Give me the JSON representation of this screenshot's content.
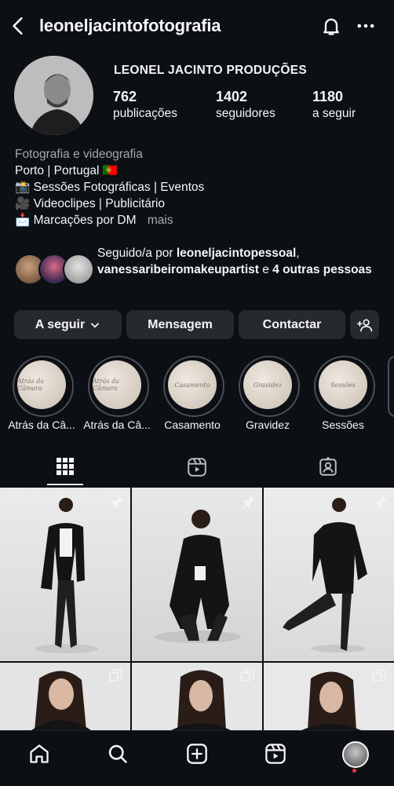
{
  "header": {
    "username": "leoneljacintofotografia",
    "back_icon": "chevron-left-icon",
    "bell_icon": "bell-icon",
    "more_icon": "more-horizontal-icon"
  },
  "profile": {
    "display_name": "LEONEL JACINTO PRODUÇÕES",
    "stats": [
      {
        "value": "762",
        "label": "publicações"
      },
      {
        "value": "1402",
        "label": "seguidores"
      },
      {
        "value": "1180",
        "label": "a seguir"
      }
    ],
    "bio": {
      "category": "Fotografia e videografia",
      "lines": [
        "Porto | Portugal 🇵🇹",
        "📸 Sessões Fotográficas | Eventos",
        "🎥 Videoclipes | Publicitário",
        "📩 Marcações por DM"
      ],
      "more": "mais"
    },
    "followed_by": {
      "prefix": "Seguido/a por ",
      "user1": "leoneljacintopessoal",
      "sep": ",",
      "user2": "vanessaribeiromakeupartist",
      "conj": " e ",
      "others": "4 outras pessoas"
    }
  },
  "actions": {
    "following": "A seguir",
    "message": "Mensagem",
    "contact": "Contactar"
  },
  "highlights": [
    {
      "label": "Atrás da Câ...",
      "cover": "Atrás da Câmara"
    },
    {
      "label": "Atrás da Câ...",
      "cover": "Atrás da Câmara"
    },
    {
      "label": "Casamento",
      "cover": "Casamento"
    },
    {
      "label": "Gravidez",
      "cover": "Gravidez"
    },
    {
      "label": "Sessões",
      "cover": "Sessões"
    }
  ],
  "tabs": [
    "grid-icon",
    "reels-icon",
    "tagged-icon"
  ],
  "colors": {
    "background": "#0c1014",
    "button": "#262a2f",
    "secondary_text": "#a8a8a8",
    "photo_bg": "#e6e6e6"
  }
}
